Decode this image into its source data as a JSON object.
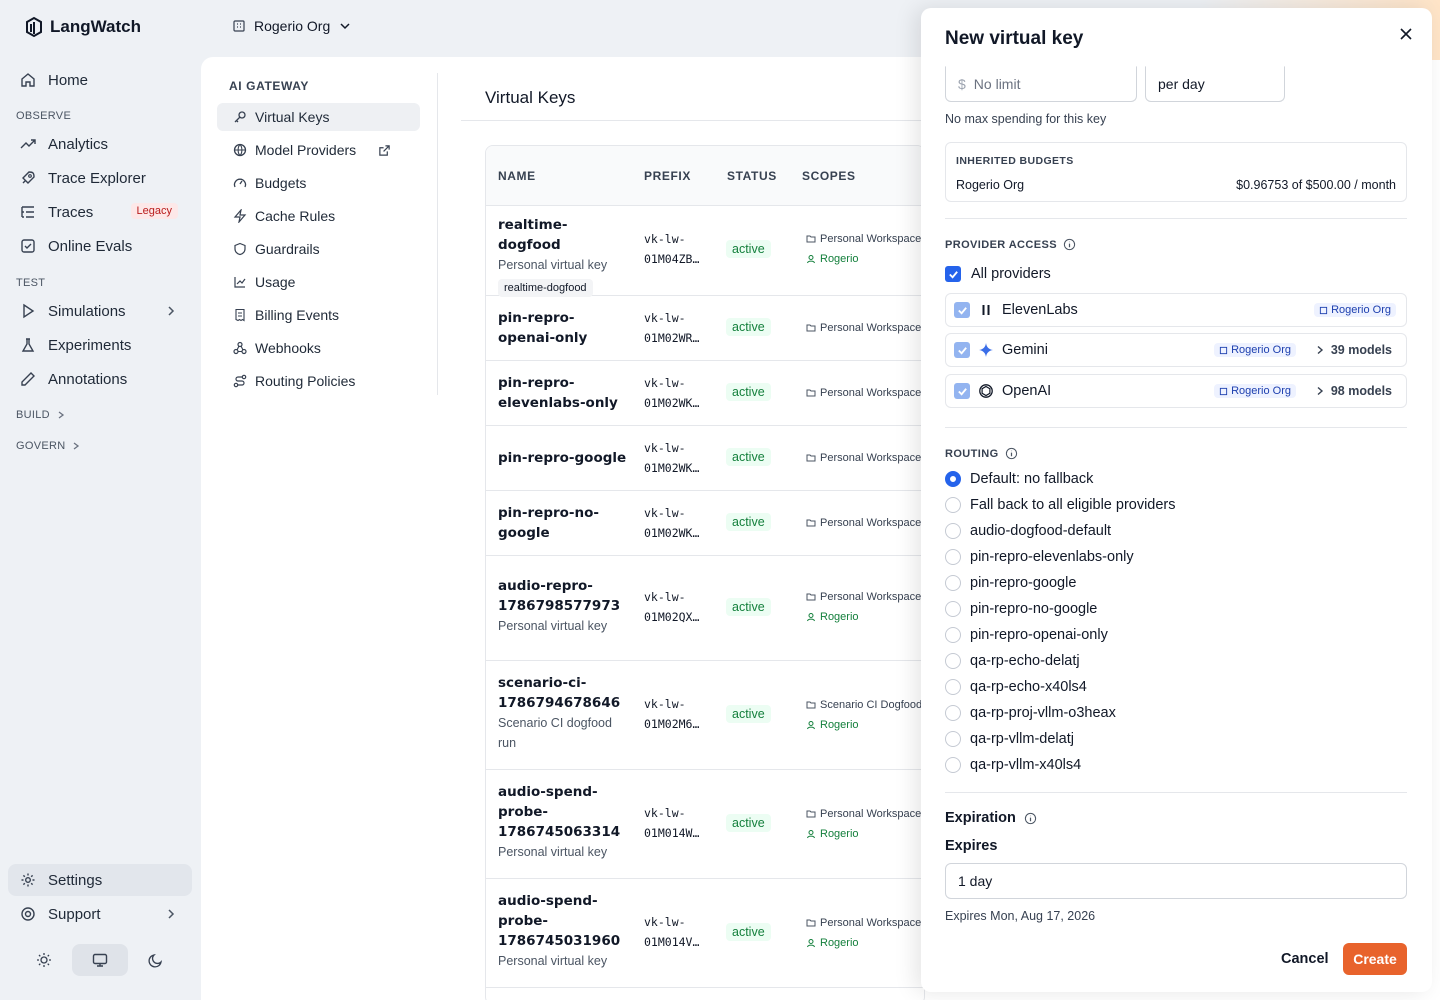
{
  "app": {
    "name": "LangWatch"
  },
  "org_switcher": {
    "label": "Rogerio Org"
  },
  "sidebar": {
    "home": "Home",
    "observe_label": "OBSERVE",
    "observe": [
      "Analytics",
      "Trace Explorer",
      "Traces",
      "Online Evals"
    ],
    "legacy_badge": "Legacy",
    "test_label": "TEST",
    "test": [
      "Simulations",
      "Experiments",
      "Annotations"
    ],
    "build_label": "BUILD",
    "govern_label": "GOVERN",
    "settings": "Settings",
    "support": "Support"
  },
  "subnav": {
    "heading": "AI GATEWAY",
    "items": [
      "Virtual Keys",
      "Model Providers",
      "Budgets",
      "Cache Rules",
      "Guardrails",
      "Usage",
      "Billing Events",
      "Webhooks",
      "Routing Policies"
    ]
  },
  "page": {
    "title": "Virtual Keys"
  },
  "table": {
    "columns": [
      "NAME",
      "PREFIX",
      "STATUS",
      "SCOPES"
    ],
    "rows": [
      {
        "name": "realtime-dogfood",
        "desc": "Personal virtual key",
        "tag": "realtime-dogfood",
        "prefix1": "vk-lw-",
        "prefix2": "01M04ZB…",
        "status": "active",
        "scope": "Personal Workspace",
        "user": "Rogerio"
      },
      {
        "name": "pin-repro-openai-only",
        "prefix1": "vk-lw-",
        "prefix2": "01M02WR…",
        "status": "active",
        "scope": "Personal Workspace"
      },
      {
        "name": "pin-repro-elevenlabs-only",
        "prefix1": "vk-lw-",
        "prefix2": "01M02WK…",
        "status": "active",
        "scope": "Personal Workspace"
      },
      {
        "name": "pin-repro-google",
        "prefix1": "vk-lw-",
        "prefix2": "01M02WK…",
        "status": "active",
        "scope": "Personal Workspace"
      },
      {
        "name": "pin-repro-no-google",
        "prefix1": "vk-lw-",
        "prefix2": "01M02WK…",
        "status": "active",
        "scope": "Personal Workspace"
      },
      {
        "name": "audio-repro-1786798577973",
        "desc": "Personal virtual key",
        "prefix1": "vk-lw-",
        "prefix2": "01M02QX…",
        "status": "active",
        "scope": "Personal Workspace",
        "user": "Rogerio"
      },
      {
        "name": "scenario-ci-1786794678646",
        "desc": "Scenario CI dogfood run",
        "prefix1": "vk-lw-",
        "prefix2": "01M02M6…",
        "status": "active",
        "scope": "Scenario CI Dogfood",
        "user": "Rogerio"
      },
      {
        "name": "audio-spend-probe-1786745063314",
        "desc": "Personal virtual key",
        "prefix1": "vk-lw-",
        "prefix2": "01M014W…",
        "status": "active",
        "scope": "Personal Workspace",
        "user": "Rogerio"
      },
      {
        "name": "audio-spend-probe-1786745031960",
        "desc": "Personal virtual key",
        "prefix1": "vk-lw-",
        "prefix2": "01M014V…",
        "status": "active",
        "scope": "Personal Workspace",
        "user": "Rogerio"
      }
    ]
  },
  "drawer": {
    "title": "New virtual key",
    "budget": {
      "currency": "$",
      "placeholder": "No limit",
      "period": "per day",
      "help": "No max spending for this key"
    },
    "inherited": {
      "label": "INHERITED BUDGETS",
      "org": "Rogerio Org",
      "amount": "$0.96753 of $500.00 / month"
    },
    "provider_access": {
      "label": "PROVIDER ACCESS",
      "all": "All providers",
      "providers": [
        {
          "name": "ElevenLabs",
          "icon": "elevenlabs-icon",
          "org": "Rogerio Org",
          "models": ""
        },
        {
          "name": "Gemini",
          "icon": "gemini-icon",
          "org": "Rogerio Org",
          "models": "39 models"
        },
        {
          "name": "OpenAI",
          "icon": "openai-icon",
          "org": "Rogerio Org",
          "models": "98 models"
        }
      ]
    },
    "routing": {
      "label": "ROUTING",
      "options": [
        "Default: no fallback",
        "Fall back to all eligible providers",
        "audio-dogfood-default",
        "pin-repro-elevenlabs-only",
        "pin-repro-google",
        "pin-repro-no-google",
        "pin-repro-openai-only",
        "qa-rp-echo-delatj",
        "qa-rp-echo-x40ls4",
        "qa-rp-proj-vllm-o3heax",
        "qa-rp-vllm-delatj",
        "qa-rp-vllm-x40ls4"
      ],
      "selected": 0
    },
    "expiration": {
      "label": "Expiration",
      "field_label": "Expires",
      "value": "1 day",
      "help": "Expires Mon, Aug 17, 2026"
    },
    "cancel": "Cancel",
    "create": "Create"
  },
  "colors": {
    "accent": "#e8632c",
    "primary": "#2563eb",
    "active": "#15803d"
  }
}
